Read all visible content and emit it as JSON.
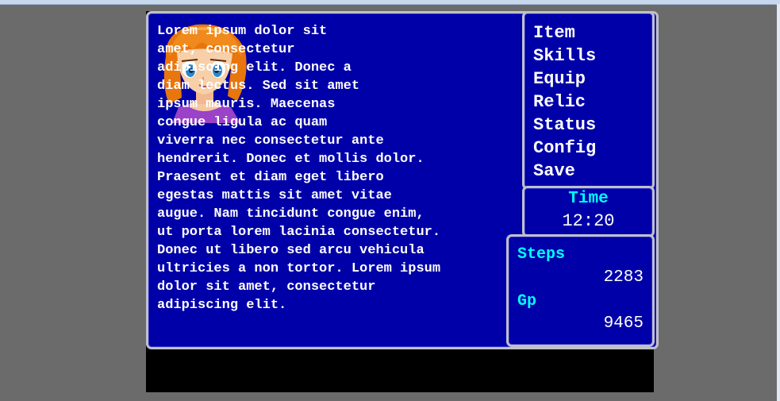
{
  "dialog": {
    "text": "Lorem ipsum dolor sit\namet, consectetur\nadipiscing elit. Donec a\ndiam lectus. Sed sit amet\nipsum mauris. Maecenas\ncongue ligula ac quam\nviverra nec consectetur ante\nhendrerit. Donec et mollis dolor.\nPraesent et diam eget libero\negestas mattis sit amet vitae\naugue. Nam tincidunt congue enim,\nut porta lorem lacinia consectetur.\nDonec ut libero sed arcu vehicula\nultricies a non tortor. Lorem ipsum\ndolor sit amet, consectetur\nadipiscing elit."
  },
  "menu": {
    "items": [
      {
        "label": "Item"
      },
      {
        "label": "Skills"
      },
      {
        "label": "Equip"
      },
      {
        "label": "Relic"
      },
      {
        "label": "Status"
      },
      {
        "label": "Config"
      },
      {
        "label": "Save"
      }
    ]
  },
  "time": {
    "label": "Time",
    "value": "12:20"
  },
  "stats": {
    "steps_label": "Steps",
    "steps_value": "2283",
    "gp_label": "Gp",
    "gp_value": "9465"
  },
  "colors": {
    "window_bg": "#0000a8",
    "window_border": "#c0c0c8",
    "text": "#ffffff",
    "label": "#00ffff"
  },
  "icons": {
    "portrait": "character-portrait"
  }
}
